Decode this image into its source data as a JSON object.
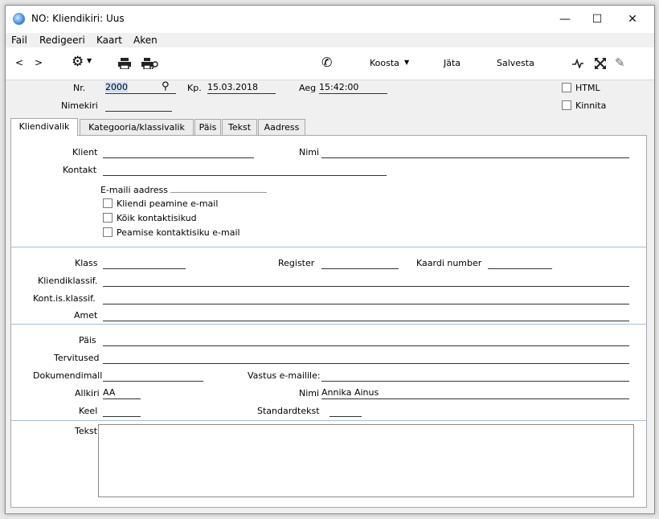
{
  "window": {
    "title": "NO: Kliendikiri: Uus",
    "minimize": "—",
    "maximize": "☐",
    "close": "✕"
  },
  "menu": [
    "Fail",
    "Redigeeri",
    "Kaart",
    "Aken"
  ],
  "toolbar": {
    "back": "<",
    "forward": ">",
    "koosta": "Koosta",
    "jata": "Jäta",
    "salvesta": "Salvesta"
  },
  "header": {
    "nr_label": "Nr.",
    "nr_value": "2000",
    "kp_label": "Kp.",
    "kp_value": "15.03.2018",
    "aeg_label": "Aeg",
    "aeg_value": "15:42:00",
    "nimekiri_label": "Nimekiri",
    "nimekiri_value": "",
    "html_label": "HTML",
    "kinnita_label": "Kinnita"
  },
  "tabs": [
    "Kliendivalik",
    "Kategooria/klassivalik",
    "Päis",
    "Tekst",
    "Aadress"
  ],
  "section1": {
    "klient_label": "Klient",
    "klient_value": "",
    "nimi_label": "Nimi",
    "nimi_value": "",
    "kontakt_label": "Kontakt",
    "kontakt_value": "",
    "email_label": "E-maili aadress",
    "email_value": "",
    "opt1": "Kliendi peamine e-mail",
    "opt2": "Kõik kontaktisikud",
    "opt3": "Peamise kontaktisiku e-mail"
  },
  "section2": {
    "klass_label": "Klass",
    "klass_value": "",
    "register_label": "Register",
    "register_value": "",
    "kaardi_label": "Kaardi number",
    "kaardi_value": "",
    "kliendiklassif_label": "Kliendiklassif.",
    "kliendiklassif_value": "",
    "kontisklassif_label": "Kont.is.klassif.",
    "kontisklassif_value": "",
    "amet_label": "Amet",
    "amet_value": ""
  },
  "section3": {
    "pais_label": "Päis",
    "pais_value": "",
    "tervitused_label": "Tervitused",
    "tervitused_value": "",
    "dokumendimall_label": "Dokumendimall",
    "dokumendimall_value": "",
    "vastus_label": "Vastus e-mailile:",
    "vastus_value": "",
    "allkiri_label": "Allkiri",
    "allkiri_value": "AA",
    "nimi_label": "Nimi",
    "nimi_value": "Annika Ainus",
    "keel_label": "Keel",
    "keel_value": "",
    "standardtekst_label": "Standardtekst",
    "standardtekst_value": ""
  },
  "section4": {
    "tekst_label": "Tekst",
    "tekst_value": ""
  },
  "colors": {
    "selection": "#cce0f7",
    "separator": "#a9bdd4"
  }
}
